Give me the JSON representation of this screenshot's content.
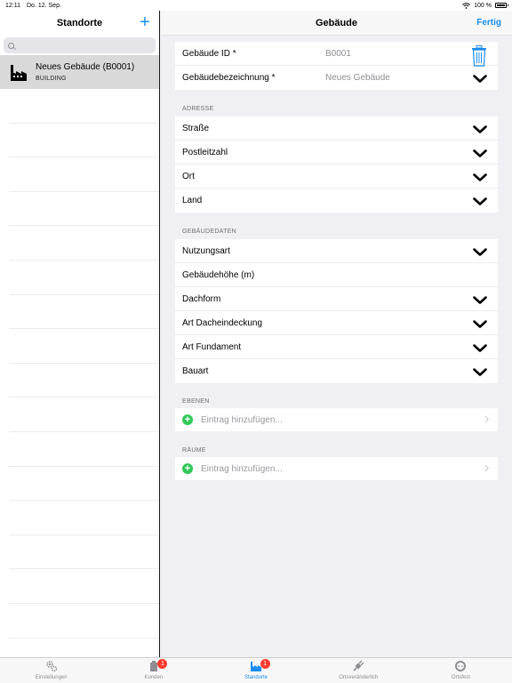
{
  "status_bar": {
    "time": "12:11",
    "date": "Do. 12. Sep.",
    "battery": "100 %"
  },
  "master": {
    "title": "Standorte",
    "search_placeholder": "",
    "items": [
      {
        "title": "Neues Gebäude (B0001)",
        "subtitle": "BUILDING"
      }
    ]
  },
  "detail": {
    "title": "Gebäude",
    "done_label": "Fertig",
    "main": {
      "id_label": "Gebäude ID *",
      "id_value": "B0001",
      "name_label": "Gebäudebezeichnung *",
      "name_value": "Neues Gebäude"
    },
    "adresse": {
      "title": "ADRESSE",
      "rows": [
        "Straße",
        "Postleitzahl",
        "Ort",
        "Land"
      ]
    },
    "gebaeudedaten": {
      "title": "GEBÄUDEDATEN",
      "rows": [
        "Nutzungsart",
        "Gebäudehöhe (m)",
        "Dachform",
        "Art Dacheindeckung",
        "Art Fundament",
        "Bauart"
      ]
    },
    "ebenen": {
      "title": "EBENEN",
      "add_label": "Eintrag hinzufügen..."
    },
    "raeume": {
      "title": "RÄUME",
      "add_label": "Eintrag hinzufügen..."
    }
  },
  "tabbar": {
    "tabs": [
      {
        "label": "Einstellungen",
        "icon": "gear-icon"
      },
      {
        "label": "Kunden",
        "icon": "client-icon",
        "badge": "1"
      },
      {
        "label": "Standorte",
        "icon": "building-icon",
        "badge": "1"
      },
      {
        "label": "Ortsveränderlich",
        "icon": "plug-icon"
      },
      {
        "label": "Ortsfest",
        "icon": "socket-icon"
      }
    ]
  },
  "colors": {
    "accent": "#1a8cf0",
    "add_green": "#34c759",
    "badge_red": "#ff3b30"
  }
}
